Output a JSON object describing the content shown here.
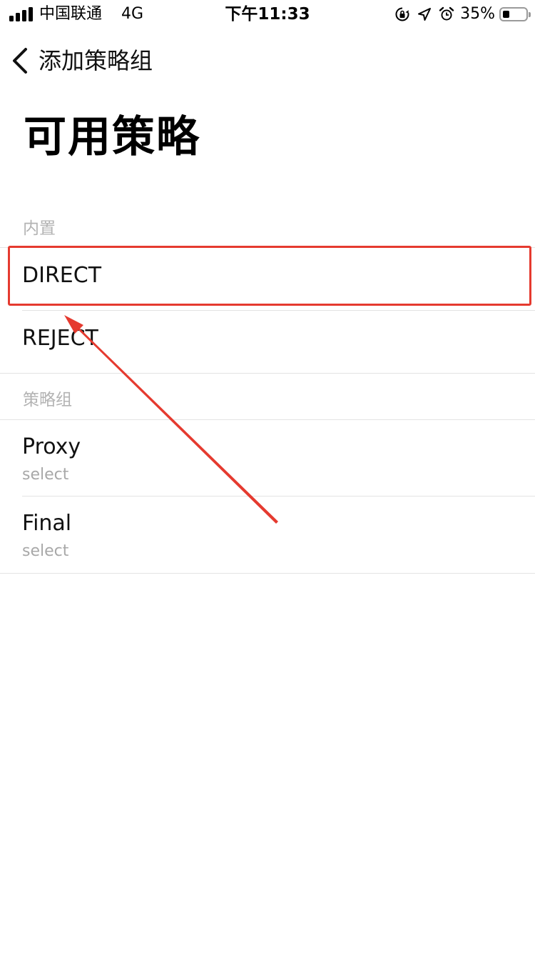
{
  "status_bar": {
    "carrier": "中国联通",
    "network": "4G",
    "time": "下午11:33",
    "battery_percent": "35%",
    "battery_level": 0.35,
    "icons": [
      "signal-icon",
      "rotation-lock-icon",
      "location-icon",
      "alarm-icon",
      "battery-icon"
    ]
  },
  "nav": {
    "back_label": "添加策略组"
  },
  "page_title": "可用策略",
  "sections": [
    {
      "header": "内置",
      "rows": [
        {
          "title": "DIRECT"
        },
        {
          "title": "REJECT"
        }
      ]
    },
    {
      "header": "策略组",
      "rows": [
        {
          "title": "Proxy",
          "subtitle": "select"
        },
        {
          "title": "Final",
          "subtitle": "select"
        }
      ]
    }
  ],
  "colors": {
    "annotation": "#e53a2f",
    "separator": "#e3e3e3",
    "secondary_text": "#a8a8a8"
  }
}
